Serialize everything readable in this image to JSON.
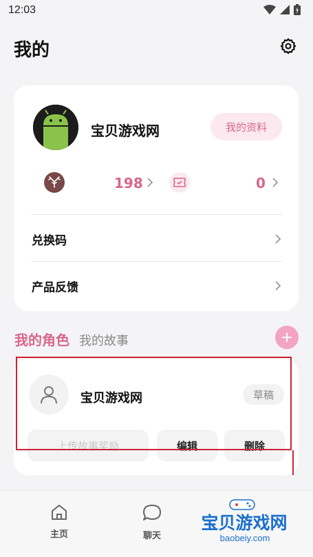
{
  "status_bar": {
    "time": "12:03"
  },
  "header": {
    "title": "我的"
  },
  "profile": {
    "username": "宝贝游戏网",
    "my_info_label": "我的资料",
    "stats": [
      {
        "icon": "antler-badge-icon",
        "value": "198"
      },
      {
        "icon": "ticket-icon",
        "value": "0"
      }
    ],
    "menu": [
      {
        "label": "兑换码"
      },
      {
        "label": "产品反馈"
      }
    ]
  },
  "tabs": {
    "active": "我的角色",
    "inactive": "我的故事"
  },
  "role_card": {
    "name": "宝贝游戏网",
    "badge": "草稿",
    "actions": {
      "upload": "上传故事奖励",
      "edit": "编辑",
      "delete": "删除"
    }
  },
  "bottom_nav": [
    {
      "label": "主页",
      "icon": "home-icon"
    },
    {
      "label": "聊天",
      "icon": "chat-bubble-icon"
    }
  ],
  "watermark": {
    "text": "宝贝游戏网",
    "url": "baobeiy.com"
  },
  "colors": {
    "accent": "#d9668d",
    "accent_light": "#fbe9ef",
    "highlight": "#cc2233"
  }
}
